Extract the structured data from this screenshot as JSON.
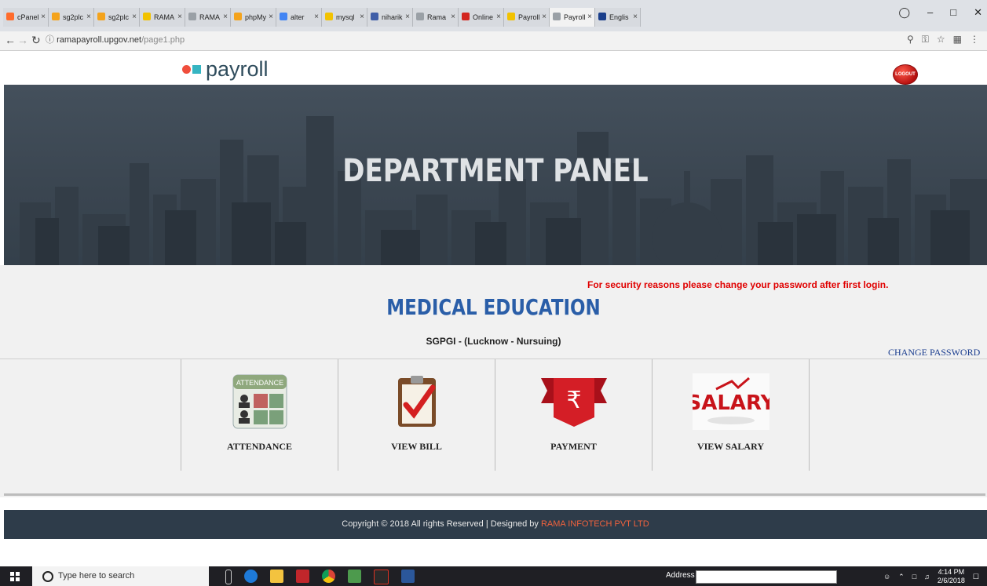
{
  "browser": {
    "tabs": [
      {
        "label": "cPanel",
        "color": "#ff6c2c"
      },
      {
        "label": "sg2plc",
        "color": "#f4a31c"
      },
      {
        "label": "sg2plc",
        "color": "#f4a31c"
      },
      {
        "label": "RAMA",
        "color": "#f2c200"
      },
      {
        "label": "RAMA",
        "color": "#9aa0a6"
      },
      {
        "label": "phpMy",
        "color": "#f4a31c"
      },
      {
        "label": "alter",
        "color": "#4285f4"
      },
      {
        "label": "mysql",
        "color": "#f2c200"
      },
      {
        "label": "niharik",
        "color": "#3f5ea8"
      },
      {
        "label": "Rama",
        "color": "#9aa0a6"
      },
      {
        "label": "Online",
        "color": "#d3261f"
      },
      {
        "label": "Payroll",
        "color": "#f2c200"
      },
      {
        "label": "Payroll",
        "color": "#9aa0a6"
      },
      {
        "label": "Englis",
        "color": "#1b3f8b"
      }
    ],
    "url_host": "ramapayroll.upgov.net",
    "url_path": "/page1.php"
  },
  "header": {
    "logo_text": "payroll",
    "logout_label": "LOGOUT"
  },
  "banner": {
    "title": "DEPARTMENT PANEL"
  },
  "content": {
    "security_notice": "For security reasons please change your password after first login.",
    "department": "MEDICAL EDUCATION",
    "unit": "SGPGI - (Lucknow - Nursuing)",
    "change_password": "CHANGE PASSWORD",
    "menu": [
      {
        "label": "ATTENDANCE",
        "icon": "attendance-icon"
      },
      {
        "label": "VIEW BILL",
        "icon": "checklist-icon"
      },
      {
        "label": "PAYMENT",
        "icon": "rupee-icon"
      },
      {
        "label": "VIEW SALARY",
        "icon": "salary-icon"
      }
    ]
  },
  "footer": {
    "text": "Copyright © 2018 All rights Reserved | Designed by",
    "company": "RAMA INFOTECH PVT LTD"
  },
  "taskbar": {
    "search_placeholder": "Type here to search",
    "address_label": "Address",
    "time": "4:14 PM",
    "date": "2/6/2018"
  }
}
